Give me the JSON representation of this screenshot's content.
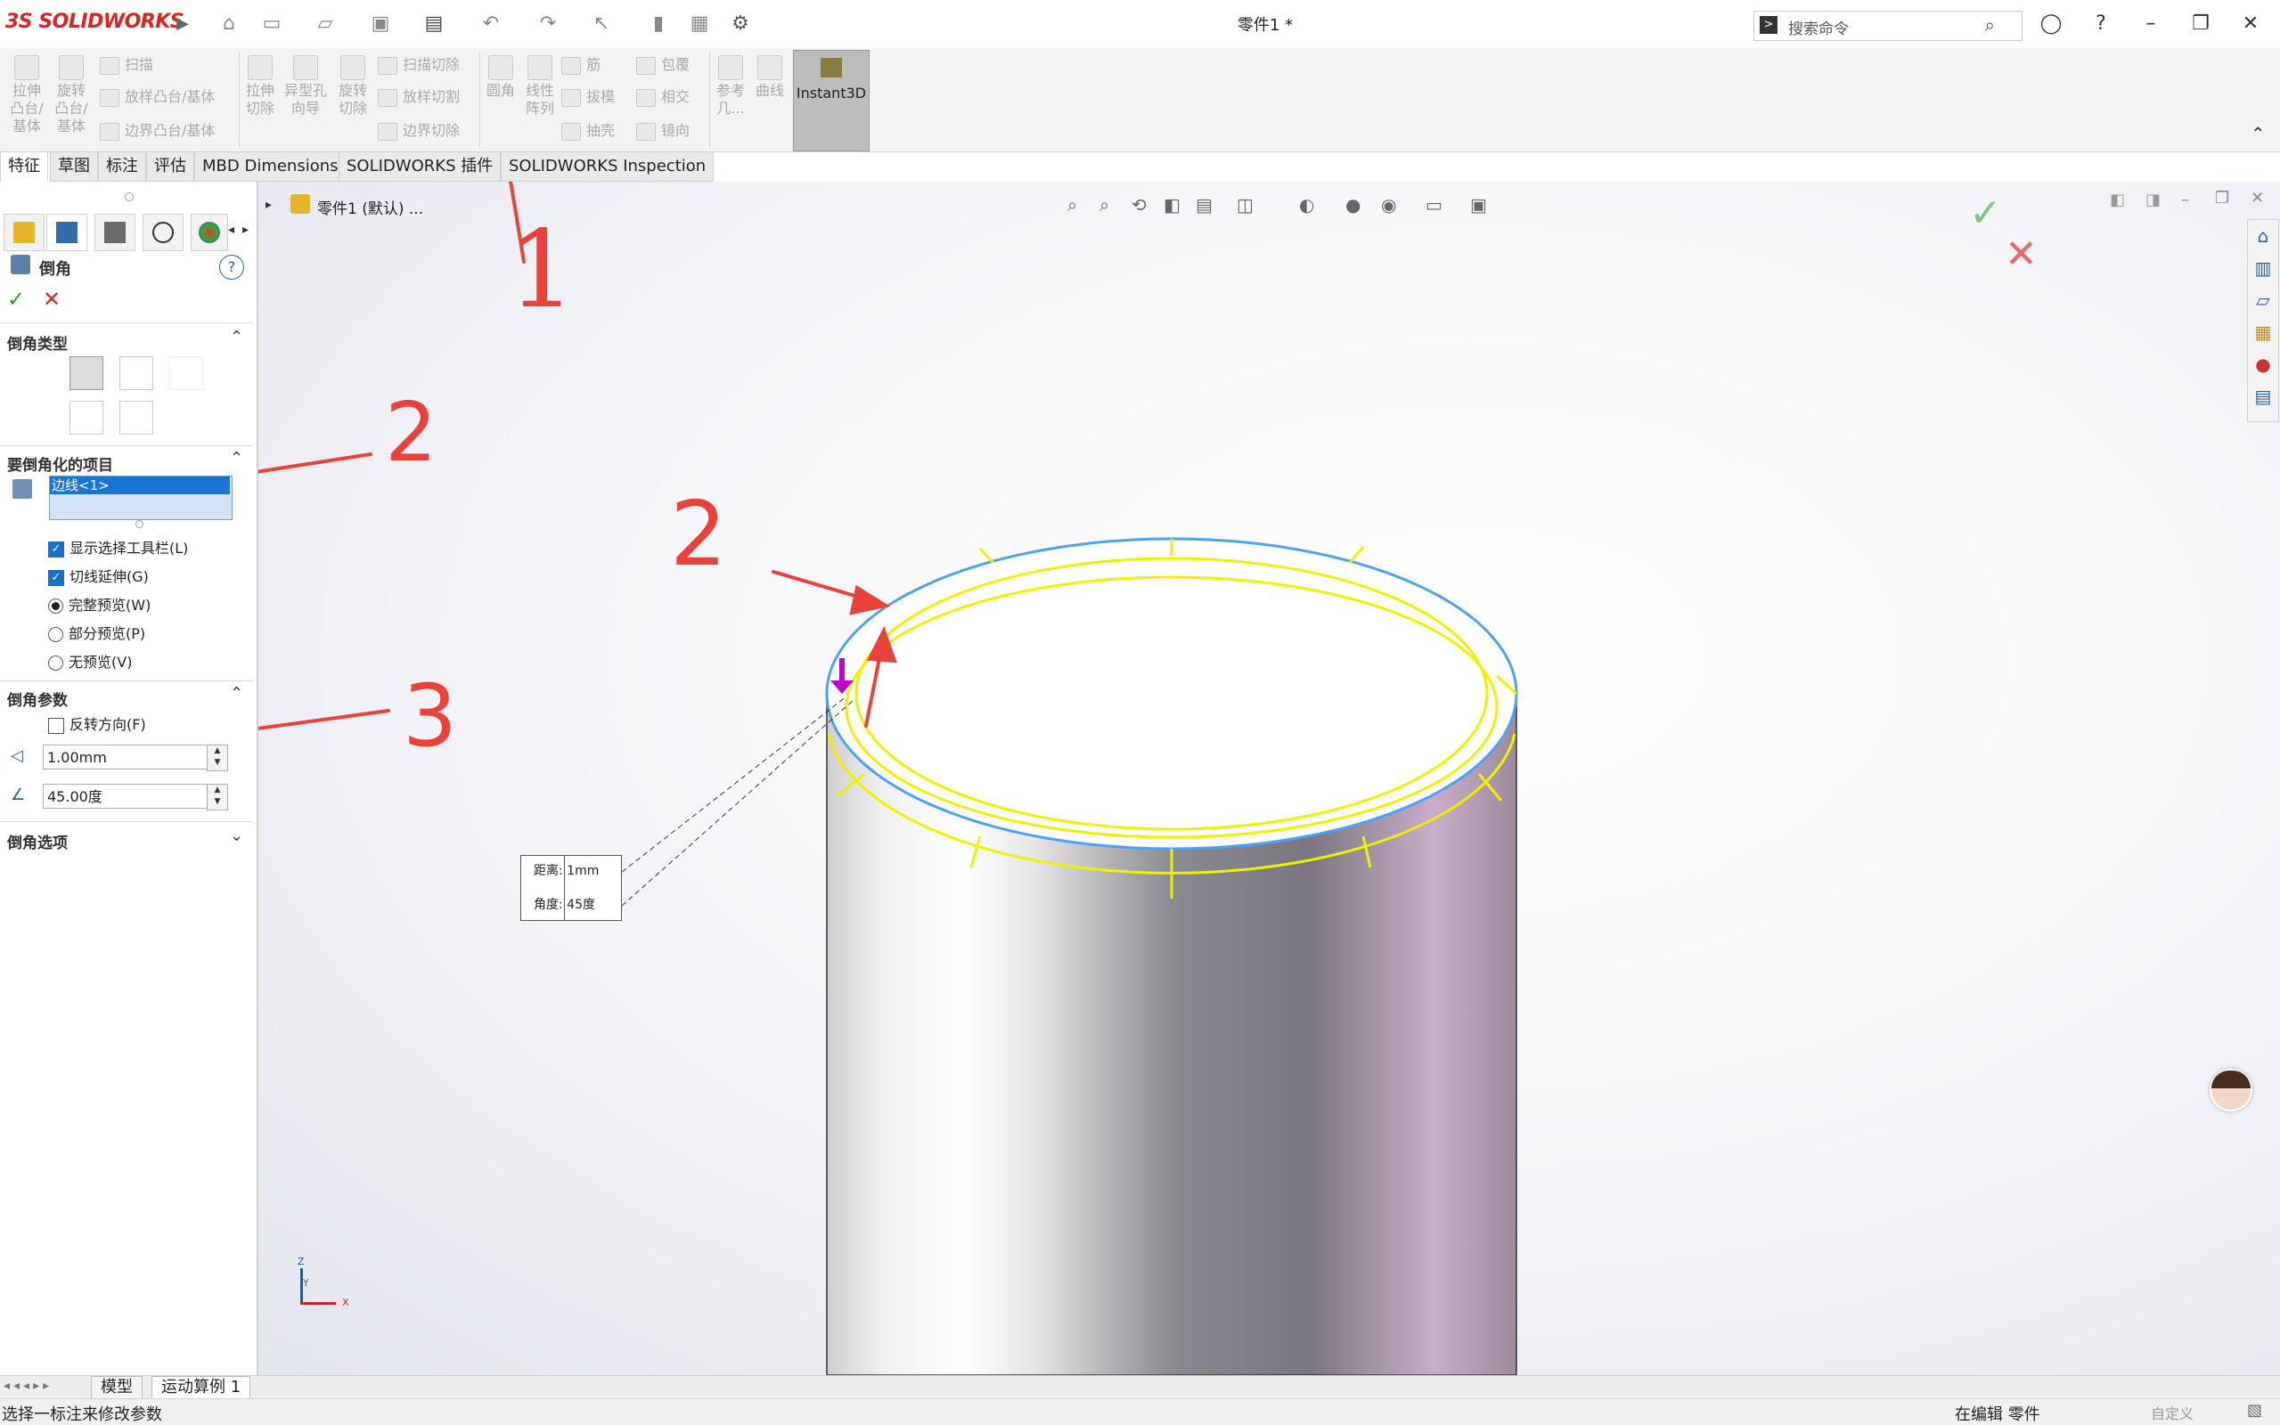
{
  "app": {
    "logo": "SOLIDWORKS",
    "title": "零件1 *"
  },
  "search": {
    "placeholder": "搜索命令"
  },
  "command_manager": {
    "col1": [
      "拉伸",
      "凸台/",
      "基体"
    ],
    "col2": [
      "旋转",
      "凸台/",
      "基体"
    ],
    "sweep": "扫描",
    "loft": "放样凸台/基体",
    "boundary": "边界凸台/基体",
    "cut_extrude": [
      "拉伸",
      "切除"
    ],
    "hole_wizard": [
      "异型孔",
      "向导"
    ],
    "revolve_cut": [
      "旋转",
      "切除"
    ],
    "swept_cut": "扫描切除",
    "lofted_cut": "放样切割",
    "boundary_cut": "边界切除",
    "fillet": "圆角",
    "linear_pattern": [
      "线性",
      "阵列"
    ],
    "rib": "筋",
    "draft": "拔模",
    "shell": "抽壳",
    "wrap": "包覆",
    "intersect": "相交",
    "mirror": "镜向",
    "reference": [
      "参考",
      "几..."
    ],
    "curves": "曲线",
    "instant3d": "Instant3D"
  },
  "tabs": [
    "特征",
    "草图",
    "标注",
    "评估",
    "MBD Dimensions",
    "SOLIDWORKS 插件",
    "SOLIDWORKS Inspection"
  ],
  "panel": {
    "title": "倒角",
    "help": "?",
    "chamfer_type": "倒角类型",
    "items_title": "要倒角化的项目",
    "selected_item": "边线<1>",
    "opt_show_toolbar": "显示选择工具栏(L)",
    "opt_tangent": "切线延伸(G)",
    "opt_full_preview": "完整预览(W)",
    "opt_partial_preview": "部分预览(P)",
    "opt_no_preview": "无预览(V)",
    "params_title": "倒角参数",
    "opt_reverse": "反转方向(F)",
    "distance_value": "1.00mm",
    "angle_value": "45.00度",
    "options_title": "倒角选项"
  },
  "tree": {
    "root": "零件1 (默认) ..."
  },
  "callout": {
    "distance": "距离: 1mm",
    "angle": "角度: 45度"
  },
  "annotations": {
    "one": "1",
    "two_a": "2",
    "two_b": "2",
    "three": "3"
  },
  "axes": {
    "x": "X",
    "y": "Y",
    "z": "Z"
  },
  "bottom_tabs": [
    "模型",
    "运动算例 1"
  ],
  "status": {
    "left": "选择一标注来修改参数",
    "editing": "在编辑 零件",
    "custom": "自定义"
  },
  "colors": {
    "accent": "#1a73d6",
    "edge_highlight": "#4aa3f0",
    "preview": "#f0f000",
    "annotation": "#e8423a"
  }
}
